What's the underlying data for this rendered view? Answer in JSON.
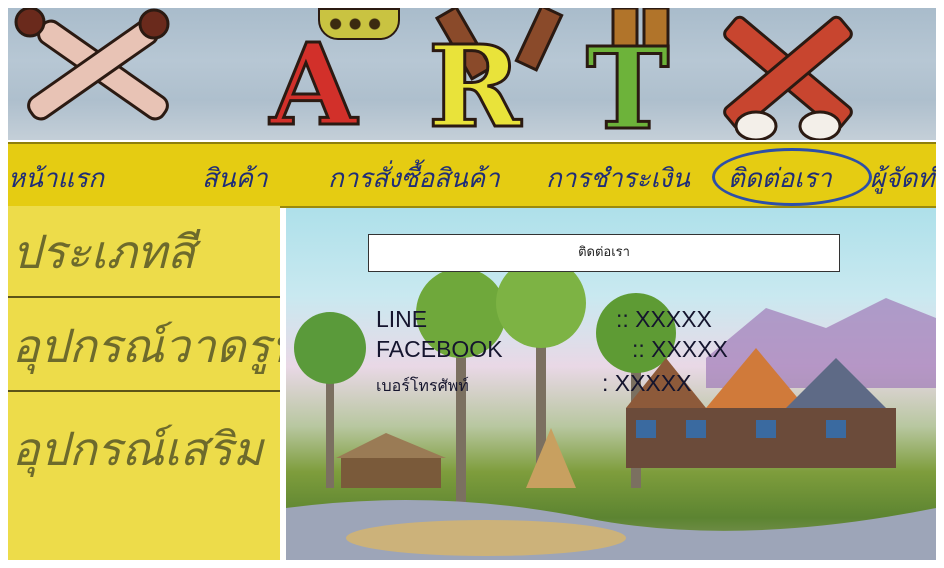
{
  "banner": {
    "letters": [
      "A",
      "R",
      "T"
    ]
  },
  "menu": {
    "items": [
      {
        "label": "หน้าแรก"
      },
      {
        "label": "สินค้า"
      },
      {
        "label": "การสั่งซื้อสินค้า"
      },
      {
        "label": "การชำระเงิน"
      },
      {
        "label": "ติดต่อเรา",
        "active": true
      },
      {
        "label": "ผู้จัดทำ"
      }
    ],
    "highlight_color": "#2d4fa8",
    "bar_color": "#e5cc12"
  },
  "sidebar": {
    "items": [
      {
        "label": "ประเภทสี"
      },
      {
        "label": "อุปกรณ์วาดรูป"
      },
      {
        "label": "อุปกรณ์เสริม"
      }
    ],
    "background": "#eddc4a"
  },
  "contact": {
    "title": "ติดต่อเรา",
    "rows": [
      {
        "label": "LINE",
        "value": ":: XXXXX"
      },
      {
        "label": "FACEBOOK",
        "value": "::  XXXXX"
      },
      {
        "label": "เบอร์โทรศัพท์",
        "value": ": XXXXX"
      }
    ]
  }
}
